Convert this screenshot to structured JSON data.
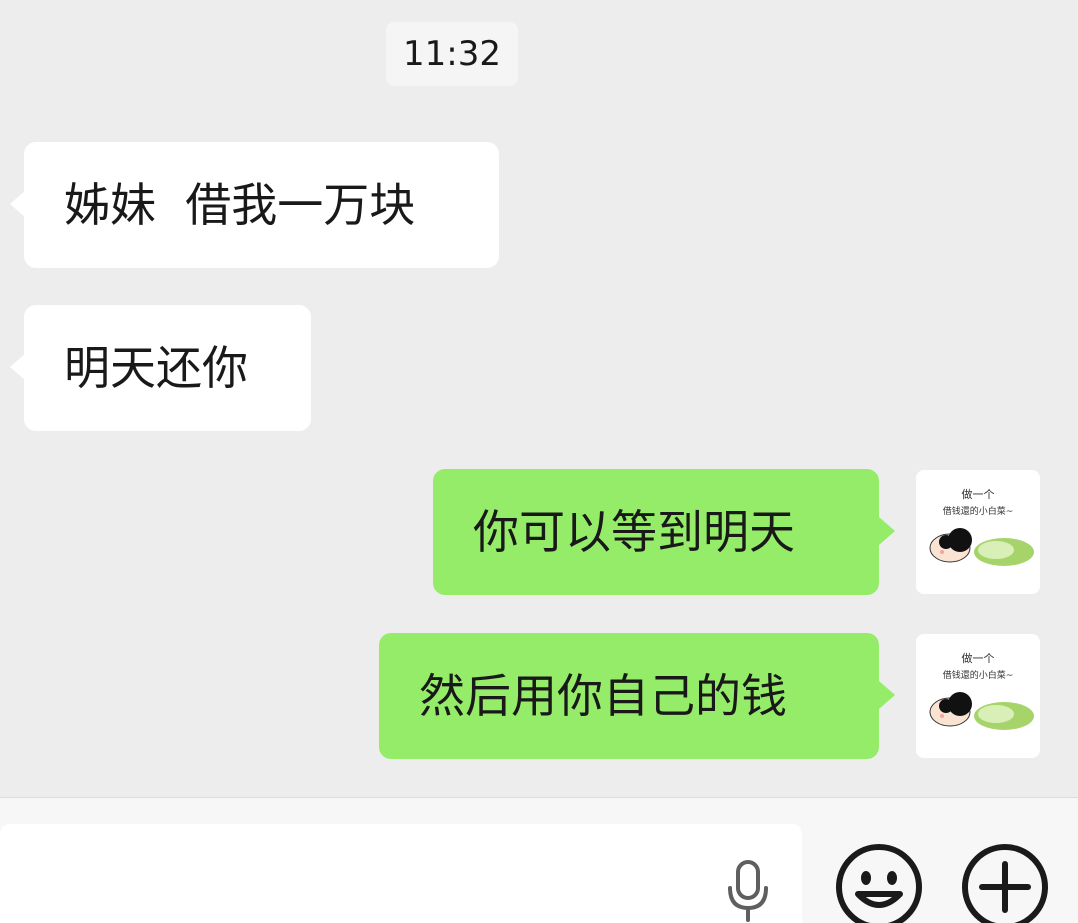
{
  "chat": {
    "timestamp": "11:32",
    "messages": [
      {
        "direction": "incoming",
        "text": "姊妹  借我一万块"
      },
      {
        "direction": "incoming",
        "text": "明天还你"
      },
      {
        "direction": "outgoing",
        "text": "你可以等到明天"
      },
      {
        "direction": "outgoing",
        "text": "然后用你自己的钱"
      }
    ]
  },
  "avatar": {
    "caption_line1": "做一个",
    "caption_line2": "借钱還的小白菜~"
  },
  "input_bar": {
    "icons": [
      "microphone-icon",
      "emoji-icon",
      "plus-icon"
    ]
  },
  "colors": {
    "background": "#ededed",
    "incoming_bubble": "#ffffff",
    "outgoing_bubble": "#95ec69",
    "text": "#191919"
  }
}
